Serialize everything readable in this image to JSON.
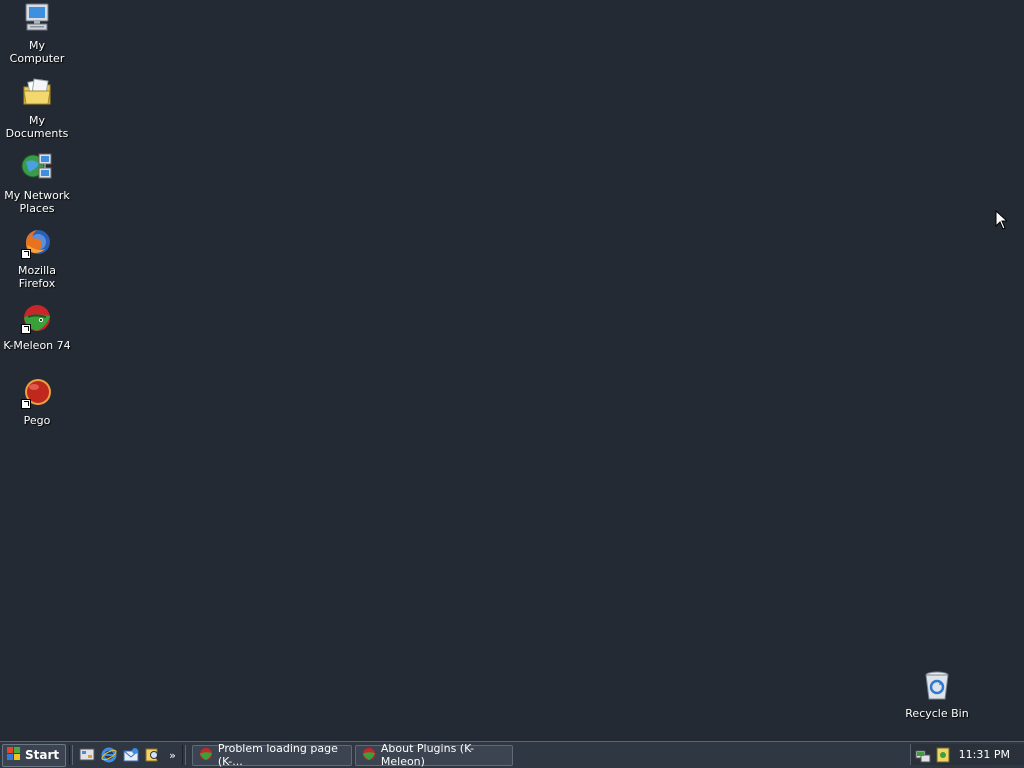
{
  "desktop": {
    "icons": [
      {
        "label": "My Computer"
      },
      {
        "label": "My Documents"
      },
      {
        "label": "My Network Places"
      },
      {
        "label": "Mozilla Firefox"
      },
      {
        "label": "K-Meleon 74"
      },
      {
        "label": "Pego"
      }
    ],
    "recycle_bin": {
      "label": "Recycle Bin"
    }
  },
  "taskbar": {
    "start_label": "Start",
    "quick_launch": [
      "show-desktop-icon",
      "internet-explorer-icon",
      "outlook-express-icon",
      "search-icon"
    ],
    "tasks": [
      {
        "label": "Problem loading page (K-..."
      },
      {
        "label": "About Plugins (K-Meleon)"
      }
    ],
    "clock": "11:31 PM"
  }
}
